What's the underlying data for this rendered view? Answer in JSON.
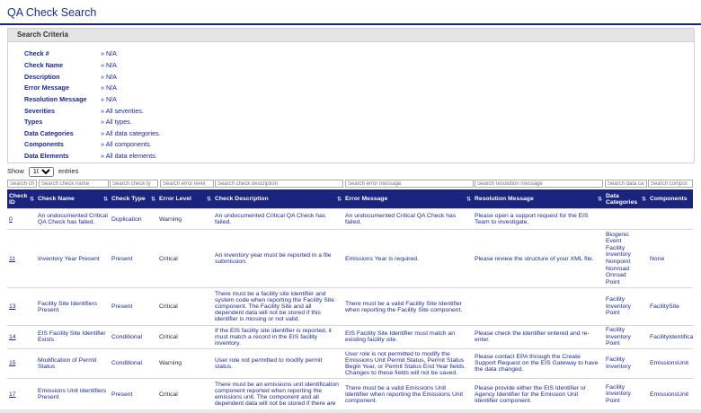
{
  "page": {
    "title": "QA Check Search"
  },
  "criteria": {
    "header": "Search Criteria",
    "rows": [
      {
        "label": "Check #",
        "value": "» N/A"
      },
      {
        "label": "Check Name",
        "value": "» N/A"
      },
      {
        "label": "Description",
        "value": "» N/A"
      },
      {
        "label": "Error Message",
        "value": "» N/A"
      },
      {
        "label": "Resolution Message",
        "value": "» N/A"
      },
      {
        "label": "Severities",
        "value": "» All severities."
      },
      {
        "label": "Types",
        "value": "» All types."
      },
      {
        "label": "Data Categories",
        "value": "» All data categories."
      },
      {
        "label": "Components",
        "value": "» All components."
      },
      {
        "label": "Data Elements",
        "value": "» All data elements."
      }
    ]
  },
  "length": {
    "show": "Show",
    "value": "10",
    "entries": "entries"
  },
  "filters": [
    "Search ch",
    "Search check name",
    "Search check ty",
    "Search error level",
    "Search check description",
    "Search error message",
    "Search resolution message",
    "Search data ca",
    "Search compor"
  ],
  "table": {
    "headers": [
      "Check ID",
      "Check Name",
      "Check Type",
      "Error Level",
      "Check Description",
      "Error Message",
      "Resolution Message",
      "Data Categories",
      "Components"
    ],
    "rows": [
      {
        "id": "0",
        "name": "An undocumented Critical QA Check has failed.",
        "type": "Duplication",
        "level": "Warning",
        "desc": "An undocumented Critical QA Check has failed.",
        "err": "An undocumented Critical QA Check has failed.",
        "res": "Please open a support request for the EIS Team to investigate.",
        "cats": [],
        "comp": ""
      },
      {
        "id": "11",
        "name": "Inventory Year Present",
        "type": "Present",
        "level": "Critical",
        "desc": "An inventory year must be reported in a file submission.",
        "err": "Emissions Year is required.",
        "res": "Please review the structure of your XML file.",
        "cats": [
          "Biogenic",
          "Event",
          "Facility",
          "Inventory",
          "Nonpoint",
          "Nonroad",
          "Onroad",
          "Point"
        ],
        "comp": "None"
      },
      {
        "id": "13",
        "name": "Facility Site Identifiers Present",
        "type": "Present",
        "level": "Critical",
        "desc": "There must be a facility site identifier and system code when reporting the Facility Site component. The Facility Site and all dependent data will not be stored if this identifier is missing or not valid.",
        "err": "There must be a valid Facility Site Identifier when reporting the Facility Site component.",
        "res": "",
        "cats": [
          "Facility",
          "Inventory",
          "Point"
        ],
        "comp": "FacilitySite"
      },
      {
        "id": "14",
        "name": "EIS Facility Site Identifier Exists",
        "type": "Conditional",
        "level": "Critical",
        "desc": "If the EIS facility site identifier is reported, it must match a record in the EIS facility inventory.",
        "err": "EIS Facility Site Identifier must match an existing facility site.",
        "res": "Please check the identifier entered and re-enter.",
        "cats": [
          "Facility",
          "Inventory",
          "Point"
        ],
        "comp": "FacilityIdentifica"
      },
      {
        "id": "15",
        "name": "Modification of Permit Status",
        "type": "Conditional",
        "level": "Warning",
        "desc": "User role not permitted to modify permit status.",
        "err": "User role is not permitted to modify the Emissions Unit Permit Status, Permit Status Begin Year, or Permit Status End Year fields. Changes to these fields will not be saved.",
        "res": "Please contact EPA through the Create Support Request on the EIS Gateway to have the data changed.",
        "cats": [
          "Facility",
          "Inventory"
        ],
        "comp": "EmissionsUnit"
      },
      {
        "id": "17",
        "name": "Emissions Unit Identifiers Present",
        "type": "Present",
        "level": "Critical",
        "desc": "There must be an emissions unit identification component reported when reporting the emissions unit. The component and all dependent data will not be stored if there are",
        "err": "There must be a valid Emissions Unit Identifier when reporting the Emissions Unit component.",
        "res": "Please provide either the EIS Identifier or Agency Identifier for the Emission Unit Identifier component.",
        "cats": [
          "Facility",
          "Inventory",
          "Point"
        ],
        "comp": "EmissionsUnit"
      }
    ]
  }
}
